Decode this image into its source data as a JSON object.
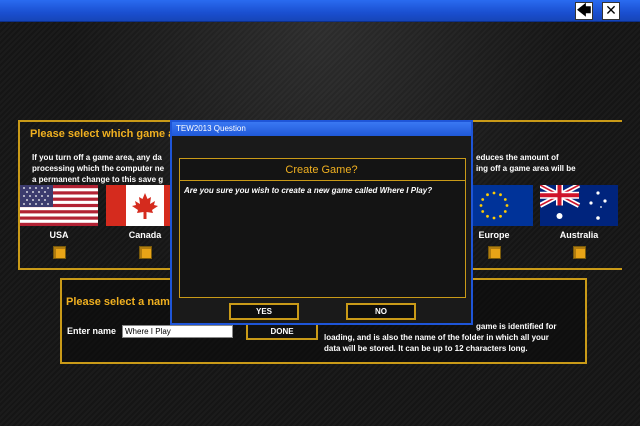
{
  "window": {
    "back_glyph": "🡄",
    "close_glyph": "✕"
  },
  "areas": {
    "heading": "Please select which game are",
    "info_left": [
      "If you turn off a game area, any da",
      "processing which the computer ne",
      "a permanent change to this save g"
    ],
    "info_right": [
      "educes the amount of",
      "ing off a game area will be"
    ],
    "countries": [
      {
        "label": "USA",
        "flag": "usa-flag"
      },
      {
        "label": "Canada",
        "flag": "canada-flag"
      },
      {
        "label": "Europe",
        "flag": "europe-flag"
      },
      {
        "label": "Australia",
        "flag": "australia-flag"
      }
    ]
  },
  "name_panel": {
    "heading": "Please select a name",
    "enter_label": "Enter name",
    "input_value": "Where I Play",
    "done_label": "DONE",
    "info": [
      "game is identified for",
      "loading, and is also the name of the folder in which all your",
      "data will be stored. It can be up to 12 characters long."
    ]
  },
  "dialog": {
    "title": "TEW2013 Question",
    "heading": "Create Game?",
    "message": "Are you sure you wish to create a new game called Where I Play?",
    "yes_label": "YES",
    "no_label": "NO"
  },
  "colors": {
    "accent_gold": "#c99a18",
    "heading_gold": "#f0b020",
    "titlebar_blue": "#1a4fd0"
  }
}
